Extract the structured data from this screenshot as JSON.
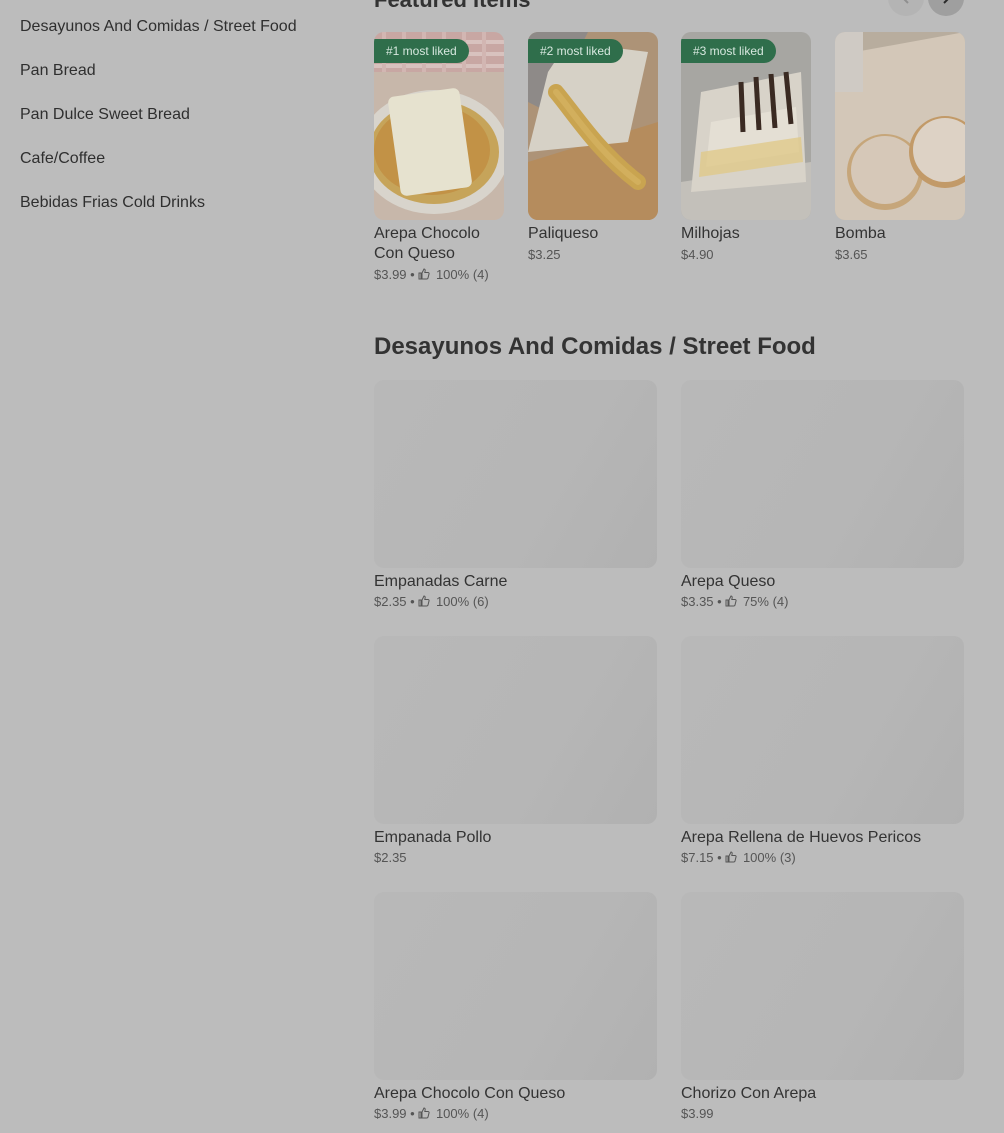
{
  "sidebar": {
    "items": [
      {
        "label": "Desayunos And Comidas / Street Food"
      },
      {
        "label": "Pan Bread"
      },
      {
        "label": "Pan Dulce Sweet Bread"
      },
      {
        "label": "Cafe/Coffee"
      },
      {
        "label": "Bebidas Frias Cold Drinks"
      }
    ]
  },
  "featured": {
    "title": "Featured Items",
    "items": [
      {
        "badge": "#1 most liked",
        "name": "Arepa Chocolo Con Queso",
        "price": "$3.99",
        "rating": "100% (4)"
      },
      {
        "badge": "#2 most liked",
        "name": "Paliqueso",
        "price": "$3.25",
        "rating": ""
      },
      {
        "badge": "#3 most liked",
        "name": "Milhojas",
        "price": "$4.90",
        "rating": ""
      },
      {
        "badge": "",
        "name": "Bomba",
        "price": "$3.65",
        "rating": ""
      }
    ]
  },
  "section": {
    "title": "Desayunos And Comidas / Street Food",
    "items": [
      {
        "name": "Empanadas Carne",
        "price": "$2.35",
        "rating": "100% (6)"
      },
      {
        "name": "Arepa Queso",
        "price": "$3.35",
        "rating": "75% (4)"
      },
      {
        "name": "Empanada Pollo",
        "price": "$2.35",
        "rating": ""
      },
      {
        "name": "Arepa Rellena de Huevos Pericos",
        "price": "$7.15",
        "rating": "100% (3)"
      },
      {
        "name": "Arepa Chocolo Con Queso",
        "price": "$3.99",
        "rating": "100% (4)"
      },
      {
        "name": "Chorizo Con Arepa",
        "price": "$3.99",
        "rating": ""
      }
    ]
  },
  "icons": {
    "prev": "chevron-left-icon",
    "next": "chevron-right-icon",
    "rating": "thumbs-up-icon"
  },
  "colors": {
    "badge_bg": "#2f6e4b",
    "overlay": "#bcbcbc"
  }
}
